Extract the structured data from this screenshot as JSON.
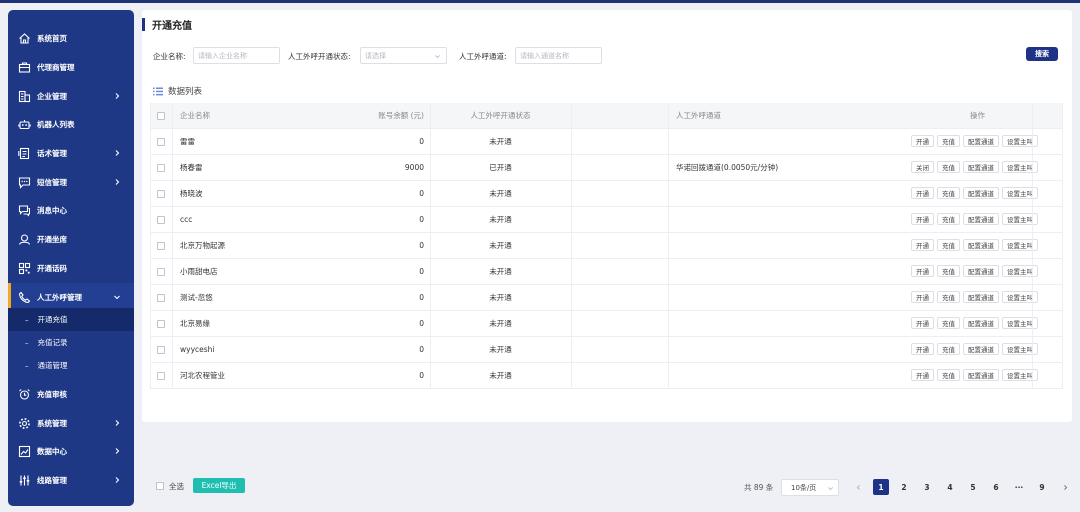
{
  "sidebar": {
    "items": [
      {
        "label": "系统首页",
        "icon": "home-icon",
        "has_children": false
      },
      {
        "label": "代理商管理",
        "icon": "briefcase-icon",
        "has_children": false
      },
      {
        "label": "企业管理",
        "icon": "building-icon",
        "has_children": true
      },
      {
        "label": "机器人列表",
        "icon": "robot-icon",
        "has_children": false
      },
      {
        "label": "话术管理",
        "icon": "script-icon",
        "has_children": true
      },
      {
        "label": "短信管理",
        "icon": "sms-icon",
        "has_children": true
      },
      {
        "label": "消息中心",
        "icon": "message-icon",
        "has_children": false
      },
      {
        "label": "开通坐席",
        "icon": "headset-icon",
        "has_children": false
      },
      {
        "label": "开通话码",
        "icon": "qrcode-icon",
        "has_children": false
      },
      {
        "label": "人工外呼管理",
        "icon": "phone-icon",
        "has_children": true,
        "expanded": true
      }
    ],
    "sub_items": [
      {
        "label": "开通充值",
        "current": true
      },
      {
        "label": "充值记录",
        "current": false
      },
      {
        "label": "通道管理",
        "current": false
      }
    ],
    "items_after": [
      {
        "label": "充值审核",
        "icon": "alarm-icon",
        "has_children": false
      },
      {
        "label": "系统管理",
        "icon": "gear-icon",
        "has_children": true
      },
      {
        "label": "数据中心",
        "icon": "chart-icon",
        "has_children": true
      },
      {
        "label": "线路管理",
        "icon": "sliders-icon",
        "has_children": true
      }
    ]
  },
  "page": {
    "title": "开通充值",
    "list_title": "数据列表"
  },
  "filters": {
    "company_label": "企业名称:",
    "company_placeholder": "请输入企业名称",
    "status_label": "人工外呼开通状态:",
    "status_placeholder": "请选择",
    "channel_label": "人工外呼通道:",
    "channel_placeholder": "请输入通道名称",
    "search_label": "搜索"
  },
  "table": {
    "columns": [
      "企业名称",
      "账号余额 (元)",
      "人工外呼开通状态",
      "人工外呼通道",
      "操作"
    ],
    "rows": [
      {
        "name": "雷雷",
        "balance": "0",
        "status": "未开通",
        "channel": "",
        "toggle": "开通"
      },
      {
        "name": "杨春雷",
        "balance": "9000",
        "status": "已开通",
        "channel": "华诺回拨通道(0.0050元/分钟)",
        "toggle": "关闭"
      },
      {
        "name": "杨晓波",
        "balance": "0",
        "status": "未开通",
        "channel": "",
        "toggle": "开通"
      },
      {
        "name": "ccc",
        "balance": "0",
        "status": "未开通",
        "channel": "",
        "toggle": "开通"
      },
      {
        "name": "北京万物起源",
        "balance": "0",
        "status": "未开通",
        "channel": "",
        "toggle": "开通"
      },
      {
        "name": "小雨甜电店",
        "balance": "0",
        "status": "未开通",
        "channel": "",
        "toggle": "开通"
      },
      {
        "name": "测试-忽悠",
        "balance": "0",
        "status": "未开通",
        "channel": "",
        "toggle": "开通"
      },
      {
        "name": "北京易缘",
        "balance": "0",
        "status": "未开通",
        "channel": "",
        "toggle": "开通"
      },
      {
        "name": "wyyceshi",
        "balance": "0",
        "status": "未开通",
        "channel": "",
        "toggle": "开通"
      },
      {
        "name": "河北农程管业",
        "balance": "0",
        "status": "未开通",
        "channel": "",
        "toggle": "开通"
      }
    ],
    "row_actions": [
      "充值",
      "配置通道",
      "设置主叫"
    ]
  },
  "footer": {
    "select_all": "全选",
    "export_label": "Excel导出",
    "total": "共 89 条",
    "page_size": "10条/页",
    "pages": [
      "1",
      "2",
      "3",
      "4",
      "5",
      "6",
      "···",
      "9"
    ],
    "current_page": "1"
  }
}
